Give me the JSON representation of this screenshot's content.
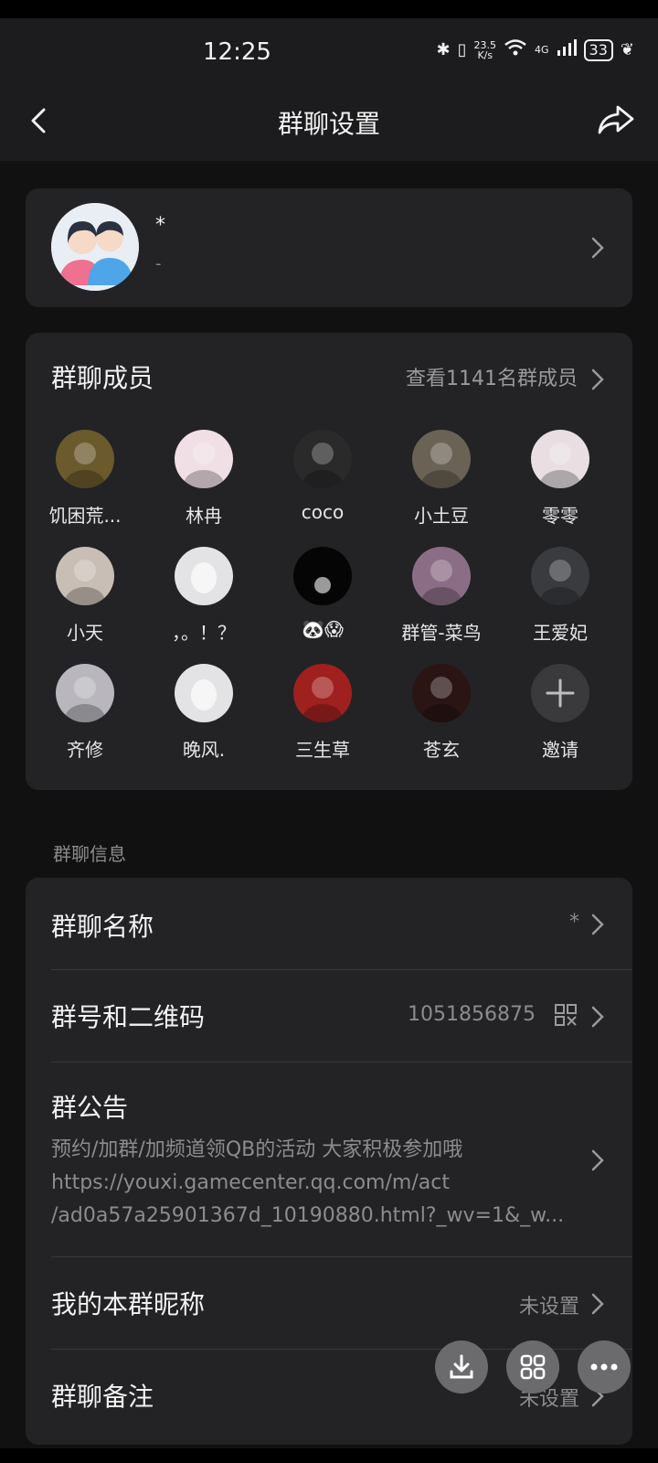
{
  "status_bar": {
    "time": "12:25",
    "speed_top": "23.5",
    "speed_bottom": "K/s",
    "network": "4G",
    "battery": "33"
  },
  "nav": {
    "title": "群聊设置",
    "back_icon": "chevron-left-icon",
    "share_icon": "share-arrow-icon"
  },
  "group": {
    "name": "*",
    "subtitle": "-"
  },
  "members": {
    "title": "群聊成员",
    "view_all": "查看1141名群成员",
    "list": [
      {
        "name": "饥困荒...",
        "color": "#6a5a2c"
      },
      {
        "name": "林冉",
        "color": "#f1dfe6"
      },
      {
        "name": "coco",
        "color": "#2a2a2a"
      },
      {
        "name": "小土豆",
        "color": "#6b6256"
      },
      {
        "name": "零零",
        "color": "#e9dfe3"
      },
      {
        "name": "小天",
        "color": "#c9beb5"
      },
      {
        "name": "，。！？",
        "color": "#e3e3e5"
      },
      {
        "name": "🐼😱",
        "color": "#050505"
      },
      {
        "name": "群管-菜鸟",
        "color": "#8b6e86"
      },
      {
        "name": "王爱妃",
        "color": "#3a3b3f"
      },
      {
        "name": "齐修",
        "color": "#b9b7bd"
      },
      {
        "name": "晚风.",
        "color": "#e3e3e5"
      },
      {
        "name": "三生草",
        "color": "#a0201f"
      },
      {
        "name": "苍玄",
        "color": "#2b1414"
      },
      {
        "name": "邀请",
        "color": "#3a3a3d"
      }
    ]
  },
  "section_label": "群聊信息",
  "info": {
    "group_name_title": "群聊名称",
    "group_name_value": "*",
    "group_id_title": "群号和二维码",
    "group_id_value": "1051856875",
    "notice_title": "群公告",
    "notice_line1": "预约/加群/加频道领QB的活动 大家积极参加哦",
    "notice_line2": "https://youxi.gamecenter.qq.com/m/act",
    "notice_line3": "/ad0a57a25901367d_10190880.html?_wv=1&_w...",
    "nickname_title": "我的本群昵称",
    "nickname_value": "未设置",
    "remark_title": "群聊备注",
    "remark_value": "未设置"
  },
  "fabs": {
    "download_icon": "download-icon",
    "apps_icon": "grid-icon",
    "more_icon": "more-dots-icon"
  }
}
